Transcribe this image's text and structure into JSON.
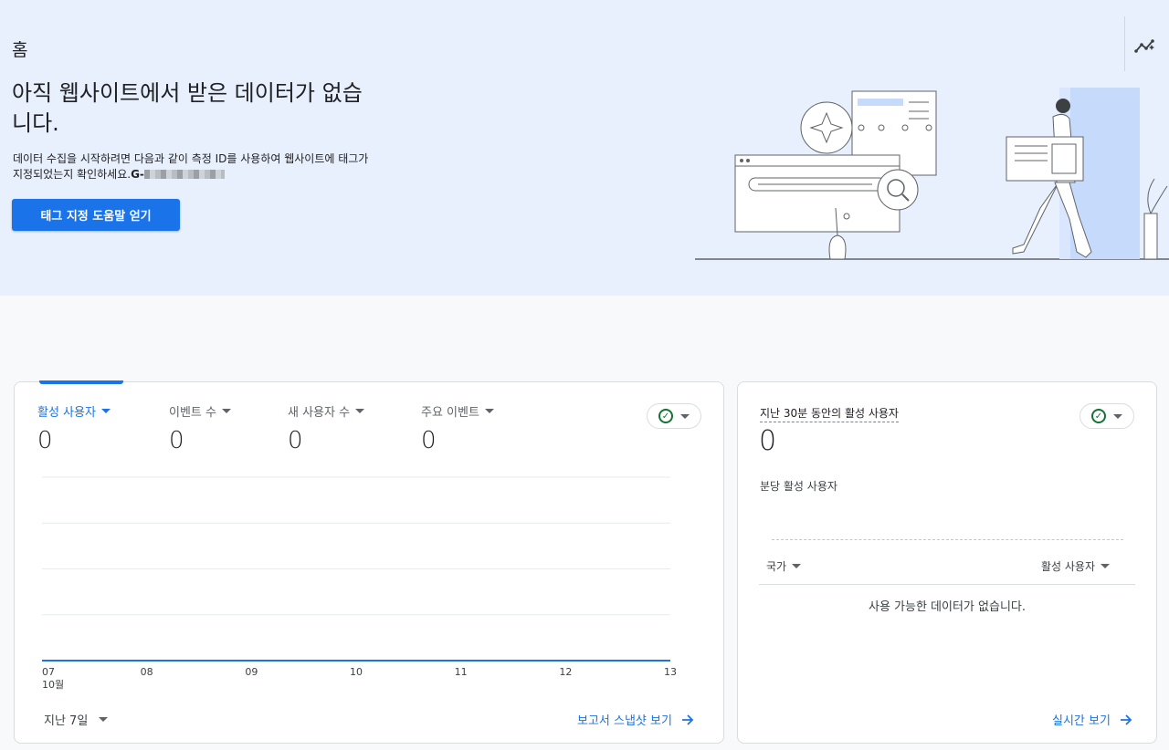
{
  "page": {
    "title": "홈"
  },
  "banner": {
    "headline": "아직 웹사이트에서 받은 데이터가 없습니다.",
    "description": "데이터 수집을 시작하려면 다음과 같이 측정 ID를 사용하여 웹사이트에 태그가 지정되었는지 확인하세요.",
    "measurement_id_prefix": "G-",
    "button_label": "태그 지정 도움말 얻기"
  },
  "main_card": {
    "metrics": [
      {
        "label": "활성 사용자",
        "value": "0",
        "active": true
      },
      {
        "label": "이벤트 수",
        "value": "0"
      },
      {
        "label": "새 사용자 수",
        "value": "0"
      },
      {
        "label": "주요 이벤트",
        "value": "0"
      }
    ],
    "date_range": "지난 7일",
    "link_label": "보고서 스냅샷 보기"
  },
  "chart_data": {
    "type": "line",
    "x": [
      "07",
      "08",
      "09",
      "10",
      "11",
      "12",
      "13"
    ],
    "x_month_label": "10월",
    "series": [
      {
        "values": [
          0,
          0,
          0,
          0,
          0,
          0,
          0
        ]
      }
    ]
  },
  "realtime_card": {
    "title": "지난 30분 동안의 활성 사용자",
    "value": "0",
    "subtitle": "분당 활성 사용자",
    "col_country": "국가",
    "col_users": "활성 사용자",
    "no_data": "사용 가능한 데이터가 없습니다.",
    "link_label": "실시간 보기"
  },
  "colors": {
    "accent": "#1a73e8",
    "banner_bg": "#e8f0fe",
    "success": "#137333"
  }
}
